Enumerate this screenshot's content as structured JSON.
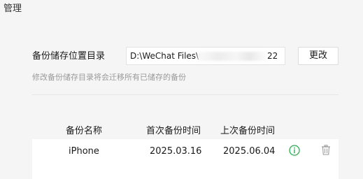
{
  "window": {
    "title": "管理"
  },
  "backup_location": {
    "label": "备份储存位置目录",
    "path_start": "D:\\WeChat Files\\w",
    "path_end": "22",
    "change_button": "更改",
    "hint": "修改备份储存目录将会迁移所有已储存的备份"
  },
  "table": {
    "columns": [
      "备份名称",
      "首次备份时间",
      "上次备份时间"
    ],
    "rows": [
      {
        "name": "iPhone",
        "first_backup": "2025.03.16",
        "last_backup": "2025.06.04"
      }
    ]
  },
  "icons": {
    "info": "info-icon",
    "delete": "trash-icon"
  },
  "colors": {
    "info_icon": "#22b34a",
    "trash_icon": "#9a9a9a",
    "hint_text": "#9a9a9a"
  }
}
